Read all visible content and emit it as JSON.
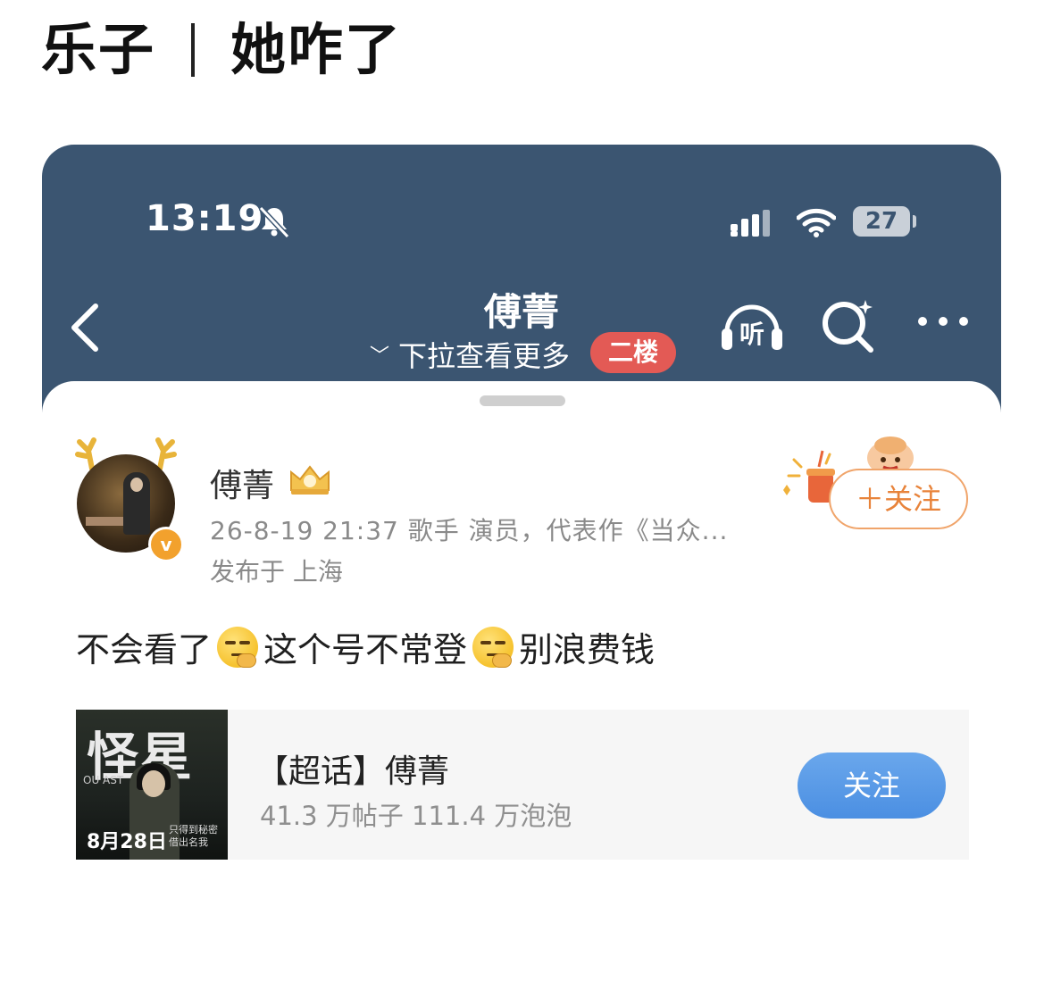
{
  "post_title": {
    "left": "乐子",
    "right": "她咋了"
  },
  "status_bar": {
    "time": "13:19",
    "battery": "27",
    "icons": [
      "bell-muted-icon",
      "signal-icon",
      "wifi-icon",
      "battery-icon"
    ]
  },
  "nav": {
    "title": "傅菁",
    "subtitle": "下拉查看更多",
    "badge": "二楼",
    "listen_label": "听",
    "icons": [
      "back-icon",
      "listen-icon",
      "search-icon",
      "more-icon"
    ]
  },
  "profile": {
    "name": "傅菁",
    "verified_mark": "v",
    "meta": "26-8-19 21:37  歌手 演员，代表作《当众...",
    "location": "发布于 上海",
    "follow_label": "＋关注"
  },
  "post": {
    "segments": [
      "不会看了",
      "这个号不常登",
      "别浪费钱"
    ],
    "emoji": "thinking-eyeroll-emoji"
  },
  "topic": {
    "title": "【超话】傅菁",
    "stats": "41.3 万帖子 111.4 万泡泡",
    "follow_label": "关注",
    "poster": {
      "title": "怪星",
      "date": "8月28日",
      "subtitle": "OU          AST",
      "small": "只得到秘密 借出名我"
    }
  },
  "colors": {
    "header_bg": "#3b5571",
    "badge_red": "#e35a55",
    "follow_orange": "#e8833a",
    "topic_blue": "#4b8fe2"
  }
}
